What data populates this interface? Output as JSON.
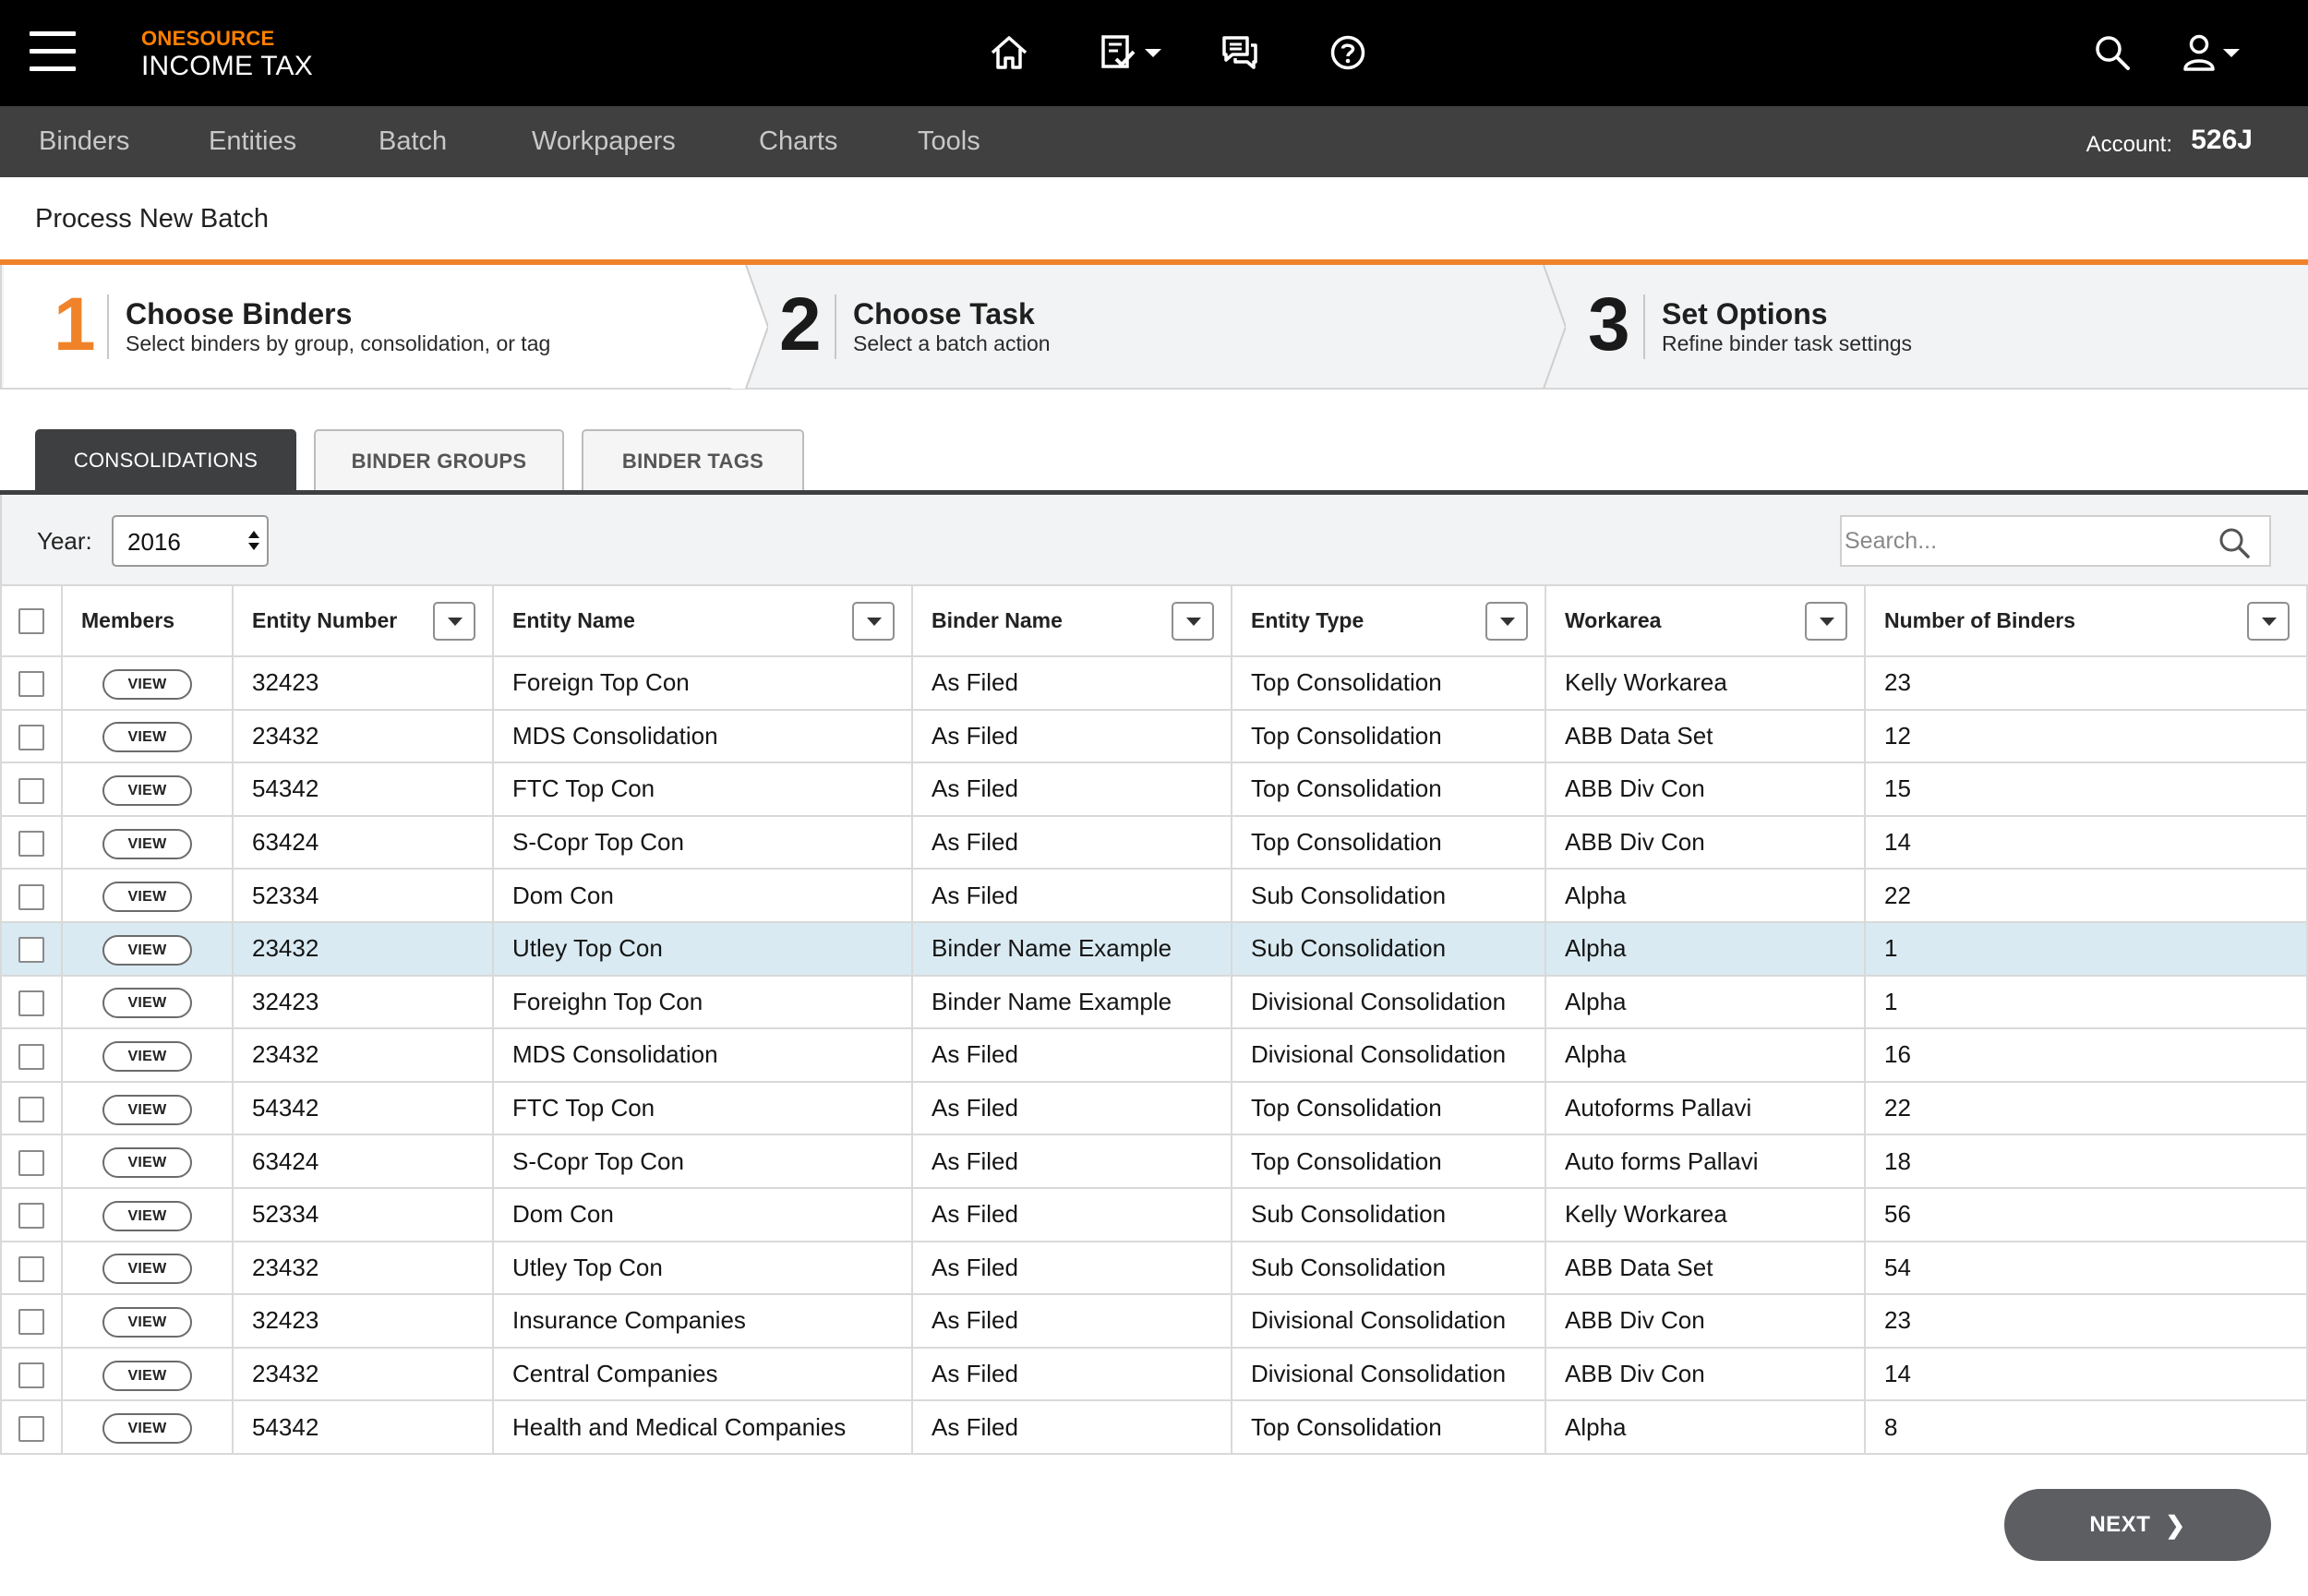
{
  "app": {
    "brand_top": "ONESOURCE",
    "brand_bottom": "INCOME TAX"
  },
  "header_icons": [
    "menu-icon",
    "home-icon",
    "tasks-icon",
    "chat-icon",
    "help-icon",
    "search-icon",
    "user-icon"
  ],
  "nav": {
    "items": [
      {
        "label": "Binders"
      },
      {
        "label": "Entities"
      },
      {
        "label": "Batch"
      },
      {
        "label": "Workpapers"
      },
      {
        "label": "Charts"
      },
      {
        "label": "Tools"
      }
    ],
    "account_label": "Account:",
    "account_value": "526J"
  },
  "page_title": "Process New Batch",
  "steps": [
    {
      "number": "1",
      "title": "Choose Binders",
      "subtitle": "Select binders by group, consolidation, or tag"
    },
    {
      "number": "2",
      "title": "Choose Task",
      "subtitle": "Select a batch action"
    },
    {
      "number": "3",
      "title": "Set Options",
      "subtitle": "Refine binder task settings"
    }
  ],
  "tabs": [
    {
      "label": "CONSOLIDATIONS"
    },
    {
      "label": "BINDER GROUPS"
    },
    {
      "label": "BINDER TAGS"
    }
  ],
  "filter": {
    "year_label": "Year:",
    "year_value": "2016",
    "search_placeholder": "Search..."
  },
  "table": {
    "columns": [
      "Members",
      "Entity Number",
      "Entity Name",
      "Binder Name",
      "Entity Type",
      "Workarea",
      "Number of Binders"
    ],
    "view_label": "VIEW",
    "rows": [
      [
        "32423",
        "Foreign Top Con",
        "As Filed",
        "Top Consolidation",
        "Kelly Workarea",
        "23"
      ],
      [
        "23432",
        "MDS Consolidation",
        "As Filed",
        "Top Consolidation",
        "ABB Data Set",
        "12"
      ],
      [
        "54342",
        "FTC Top Con",
        "As Filed",
        "Top Consolidation",
        "ABB Div Con",
        "15"
      ],
      [
        "63424",
        "S-Copr Top Con",
        "As Filed",
        "Top Consolidation",
        "ABB Div Con",
        "14"
      ],
      [
        "52334",
        "Dom Con",
        "As Filed",
        "Sub Consolidation",
        "Alpha",
        "22"
      ],
      [
        "23432",
        "Utley Top Con",
        "Binder Name Example",
        "Sub Consolidation",
        "Alpha",
        "1"
      ],
      [
        "32423",
        "Foreighn Top Con",
        "Binder Name Example",
        "Divisional Consolidation",
        "Alpha",
        "1"
      ],
      [
        "23432",
        "MDS Consolidation",
        "As Filed",
        "Divisional Consolidation",
        "Alpha",
        "16"
      ],
      [
        "54342",
        "FTC Top Con",
        "As Filed",
        "Top Consolidation",
        "Autoforms Pallavi",
        "22"
      ],
      [
        "63424",
        "S-Copr Top Con",
        "As Filed",
        "Top Consolidation",
        "Auto forms Pallavi",
        "18"
      ],
      [
        "52334",
        "Dom Con",
        "As Filed",
        "Sub Consolidation",
        "Kelly Workarea",
        "56"
      ],
      [
        "23432",
        "Utley Top Con",
        "As Filed",
        "Sub Consolidation",
        "ABB Data Set",
        "54"
      ],
      [
        "32423",
        "Insurance Companies",
        "As Filed",
        "Divisional Consolidation",
        "ABB Div Con",
        "23"
      ],
      [
        "23432",
        "Central Companies",
        "As Filed",
        "Divisional Consolidation",
        "ABB Div Con",
        "14"
      ],
      [
        "54342",
        "Health and Medical Companies",
        "As Filed",
        "Top Consolidation",
        "Alpha",
        "8"
      ]
    ]
  },
  "next_label": "NEXT",
  "colors": {
    "accent": "#f0832a",
    "topbar": "#000000",
    "navbar": "#404040",
    "highlight_row": "#d9eaf2",
    "tab_active": "#3d3f41"
  }
}
